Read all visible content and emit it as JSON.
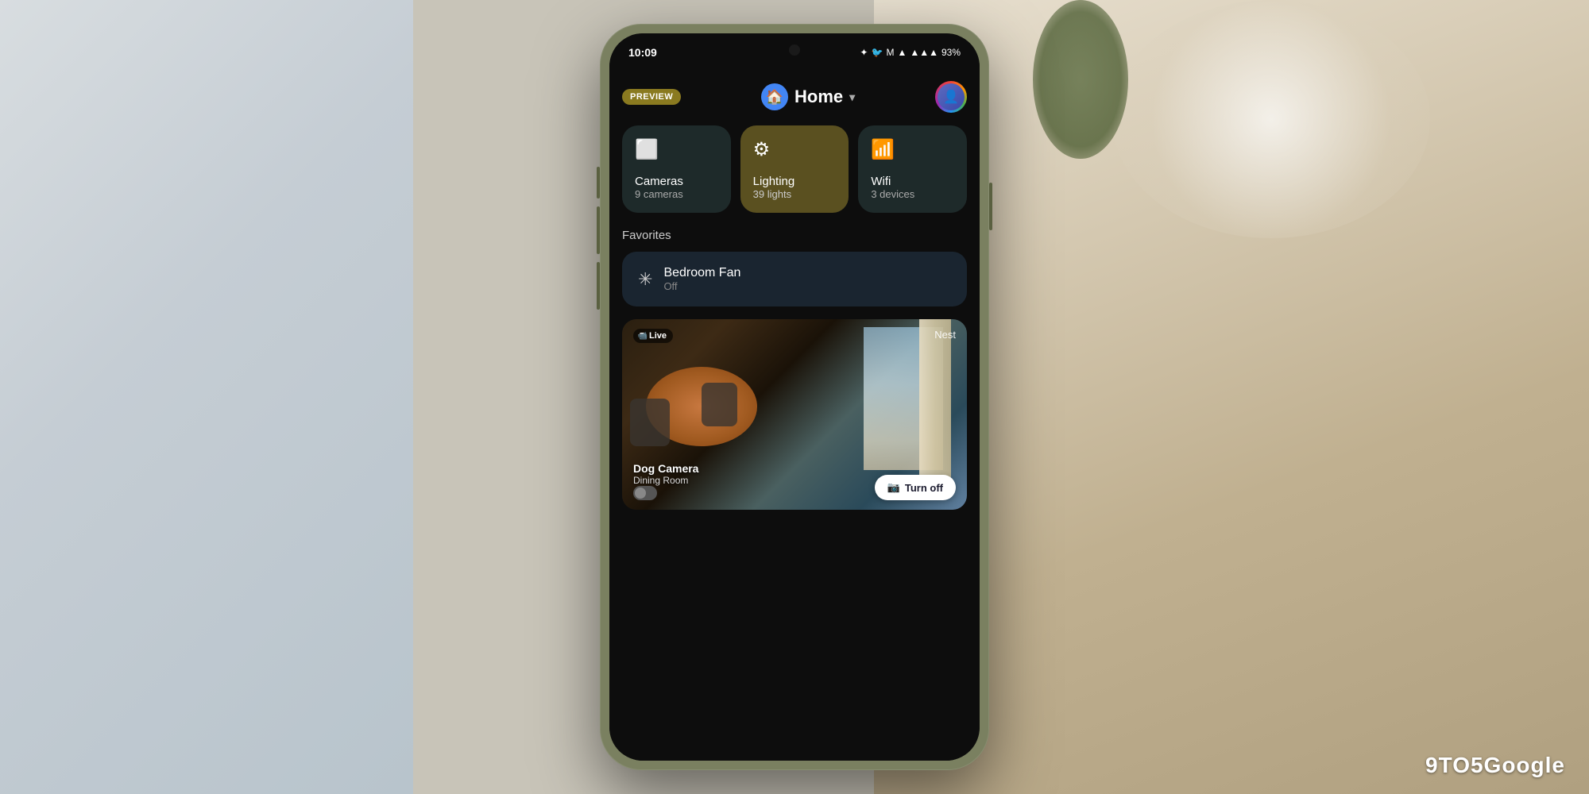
{
  "background": {
    "left_color": "#d0d8dc",
    "right_color": "#c8b890"
  },
  "watermark": "9TO5Google",
  "status_bar": {
    "time": "10:09",
    "icons": [
      "✦",
      "🐦",
      "M"
    ],
    "signal": "▲▲▲",
    "battery": "93%"
  },
  "header": {
    "preview_label": "PREVIEW",
    "home_label": "Home",
    "home_icon": "🏠"
  },
  "device_cards": [
    {
      "id": "cameras",
      "icon": "⬜",
      "name": "Cameras",
      "count": "9 cameras",
      "active": false
    },
    {
      "id": "lighting",
      "icon": "⚙",
      "name": "Lighting",
      "count": "39 lights",
      "active": true
    },
    {
      "id": "wifi",
      "icon": "📶",
      "name": "Wifi",
      "count": "3 devices",
      "active": false
    }
  ],
  "favorites": {
    "label": "Favorites",
    "items": [
      {
        "id": "bedroom-fan",
        "icon": "✳",
        "name": "Bedroom Fan",
        "status": "Off"
      }
    ]
  },
  "camera_feed": {
    "live_label": "Live",
    "brand": "Nest",
    "device_name": "Dog Camera",
    "location": "Dining Room",
    "turn_off_label": "Turn off"
  }
}
